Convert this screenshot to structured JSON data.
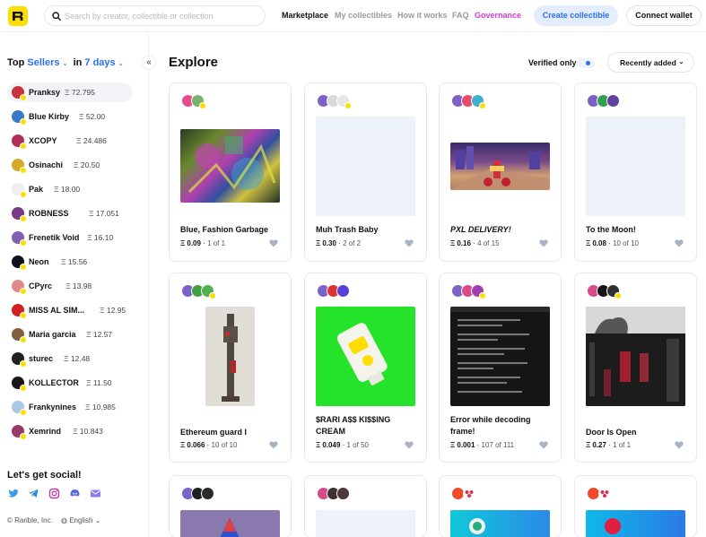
{
  "header": {
    "search_placeholder": "Search by creator, collectible or collection",
    "nav": [
      "Marketplace",
      "My collectibles",
      "How it works",
      "FAQ",
      "Governance"
    ],
    "create_button": "Create collectible",
    "wallet_button": "Connect wallet"
  },
  "sidebar": {
    "title_prefix": "Top",
    "title_kind": "Sellers",
    "title_mid": "in",
    "title_period": "7 days",
    "sellers": [
      {
        "name": "Pranksy",
        "value": "Ξ 72.795",
        "color": "#c8323c"
      },
      {
        "name": "Blue Kirby",
        "value": "Ξ 52.00",
        "color": "#3a78c8"
      },
      {
        "name": "XCOPY",
        "value": "Ξ 24.486",
        "color": "#b0305a"
      },
      {
        "name": "Osinachi",
        "value": "Ξ 20.50",
        "color": "#d9a92a"
      },
      {
        "name": "Pak",
        "value": "Ξ 18.00",
        "color": "#eeeeee"
      },
      {
        "name": "ROBNESS",
        "value": "Ξ 17.051",
        "color": "#7a3a8a"
      },
      {
        "name": "Frenetik Void",
        "value": "Ξ 16.10",
        "color": "#8060b0"
      },
      {
        "name": "Neon",
        "value": "Ξ 15.56",
        "color": "#101020"
      },
      {
        "name": "CPyrc",
        "value": "Ξ 13.98",
        "color": "#e08a8a"
      },
      {
        "name": "MISS AL SIM...",
        "value": "Ξ 12.95",
        "color": "#d02020"
      },
      {
        "name": "Maria garcia",
        "value": "Ξ 12.57",
        "color": "#806040"
      },
      {
        "name": "sturec",
        "value": "Ξ 12.48",
        "color": "#222222"
      },
      {
        "name": "KOLLECTOR",
        "value": "Ξ 11.50",
        "color": "#181818"
      },
      {
        "name": "Frankynines",
        "value": "Ξ 10.985",
        "color": "#a8c8e8"
      },
      {
        "name": "Xemrind",
        "value": "Ξ 10.843",
        "color": "#9a3a6a"
      }
    ],
    "social_title": "Let's get social!",
    "copyright": "© Rarible, Inc.",
    "language": "English"
  },
  "main": {
    "title": "Explore",
    "verified_label": "Verified only",
    "sort_label": "Recently added",
    "cards": [
      {
        "title": "Blue, Fashion Garbage",
        "price": "Ξ 0.09",
        "edition": "1 of 1"
      },
      {
        "title": "Muh Trash Baby",
        "price": "Ξ 0.30",
        "edition": "2 of 2"
      },
      {
        "title": "PXL DELIVERY!",
        "price": "Ξ 0.16",
        "edition": "4 of 15"
      },
      {
        "title": "To the Moon!",
        "price": "Ξ 0.08",
        "edition": "10 of 10"
      },
      {
        "title": "Ethereum guard I",
        "price": "Ξ 0.066",
        "edition": "10 of 10"
      },
      {
        "title": "$RARI A$$ KI$$ING CREAM",
        "price": "Ξ 0.049",
        "edition": "1 of 50"
      },
      {
        "title": "Error while decoding frame!",
        "price": "Ξ 0.001",
        "edition": "107 of 111"
      },
      {
        "title": "Door Is Open",
        "price": "Ξ 0.27",
        "edition": "1 of 1"
      }
    ]
  },
  "colors": {
    "accent": "#2d6df6",
    "brand": "#fede00",
    "governance": "#d33bd0"
  }
}
